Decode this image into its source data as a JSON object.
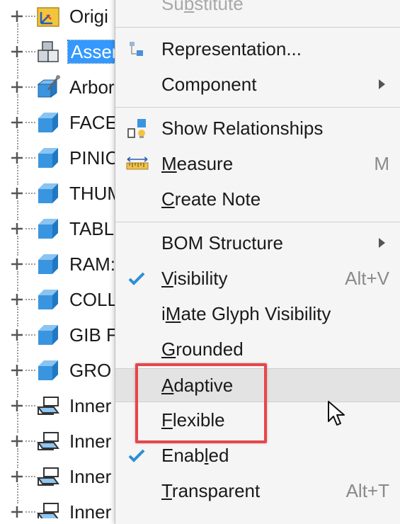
{
  "tree": {
    "items": [
      {
        "label": "Origi",
        "icon": "origin-folder-icon"
      },
      {
        "label": "Asser",
        "icon": "assembly-icon",
        "selected": true
      },
      {
        "label": "Arbor",
        "icon": "arbor-part-icon"
      },
      {
        "label": "FACE",
        "icon": "part-cube-icon"
      },
      {
        "label": "PINIC",
        "icon": "part-cube-icon"
      },
      {
        "label": "THUM",
        "icon": "part-cube-icon"
      },
      {
        "label": "TABL",
        "icon": "part-cube-icon"
      },
      {
        "label": "RAM:",
        "icon": "part-cube-icon"
      },
      {
        "label": "COLL",
        "icon": "part-cube-icon"
      },
      {
        "label": "GIB F",
        "icon": "part-cube-icon"
      },
      {
        "label": "GRO",
        "icon": "part-cube-icon"
      },
      {
        "label": "Inner",
        "icon": "plane-icon"
      },
      {
        "label": "Inner",
        "icon": "plane-icon"
      },
      {
        "label": "Inner",
        "icon": "plane-icon"
      },
      {
        "label": "Inner",
        "icon": "plane-icon"
      }
    ]
  },
  "menu": {
    "substitute": {
      "label": "Substitute",
      "mnemonic": "b"
    },
    "representation": {
      "label": "Representation..."
    },
    "component": {
      "label": "Component"
    },
    "show_relationships": {
      "label": "Show Relationships"
    },
    "measure": {
      "label": "Measure",
      "mnemonic": "M",
      "shortcut": "M"
    },
    "create_note": {
      "label": "Create Note",
      "mnemonic": "C"
    },
    "bom_structure": {
      "label": "BOM Structure"
    },
    "visibility": {
      "label": "Visibility",
      "mnemonic": "V",
      "shortcut": "Alt+V",
      "checked": true
    },
    "imate": {
      "label": "iMate Glyph Visibility",
      "mnemonic": "M"
    },
    "grounded": {
      "label": "Grounded",
      "mnemonic": "G"
    },
    "adaptive": {
      "label": "Adaptive",
      "mnemonic": "A"
    },
    "flexible": {
      "label": "Flexible",
      "mnemonic": "F"
    },
    "enabled": {
      "label": "Enabled",
      "mnemonic": "l",
      "checked": true
    },
    "transparent": {
      "label": "Transparent",
      "mnemonic": "T",
      "shortcut": "Alt+T"
    }
  },
  "colors": {
    "selection": "#3399ff",
    "highlight_box": "#e8454a",
    "check": "#2a8fd6",
    "cube": "#3a95e0"
  }
}
